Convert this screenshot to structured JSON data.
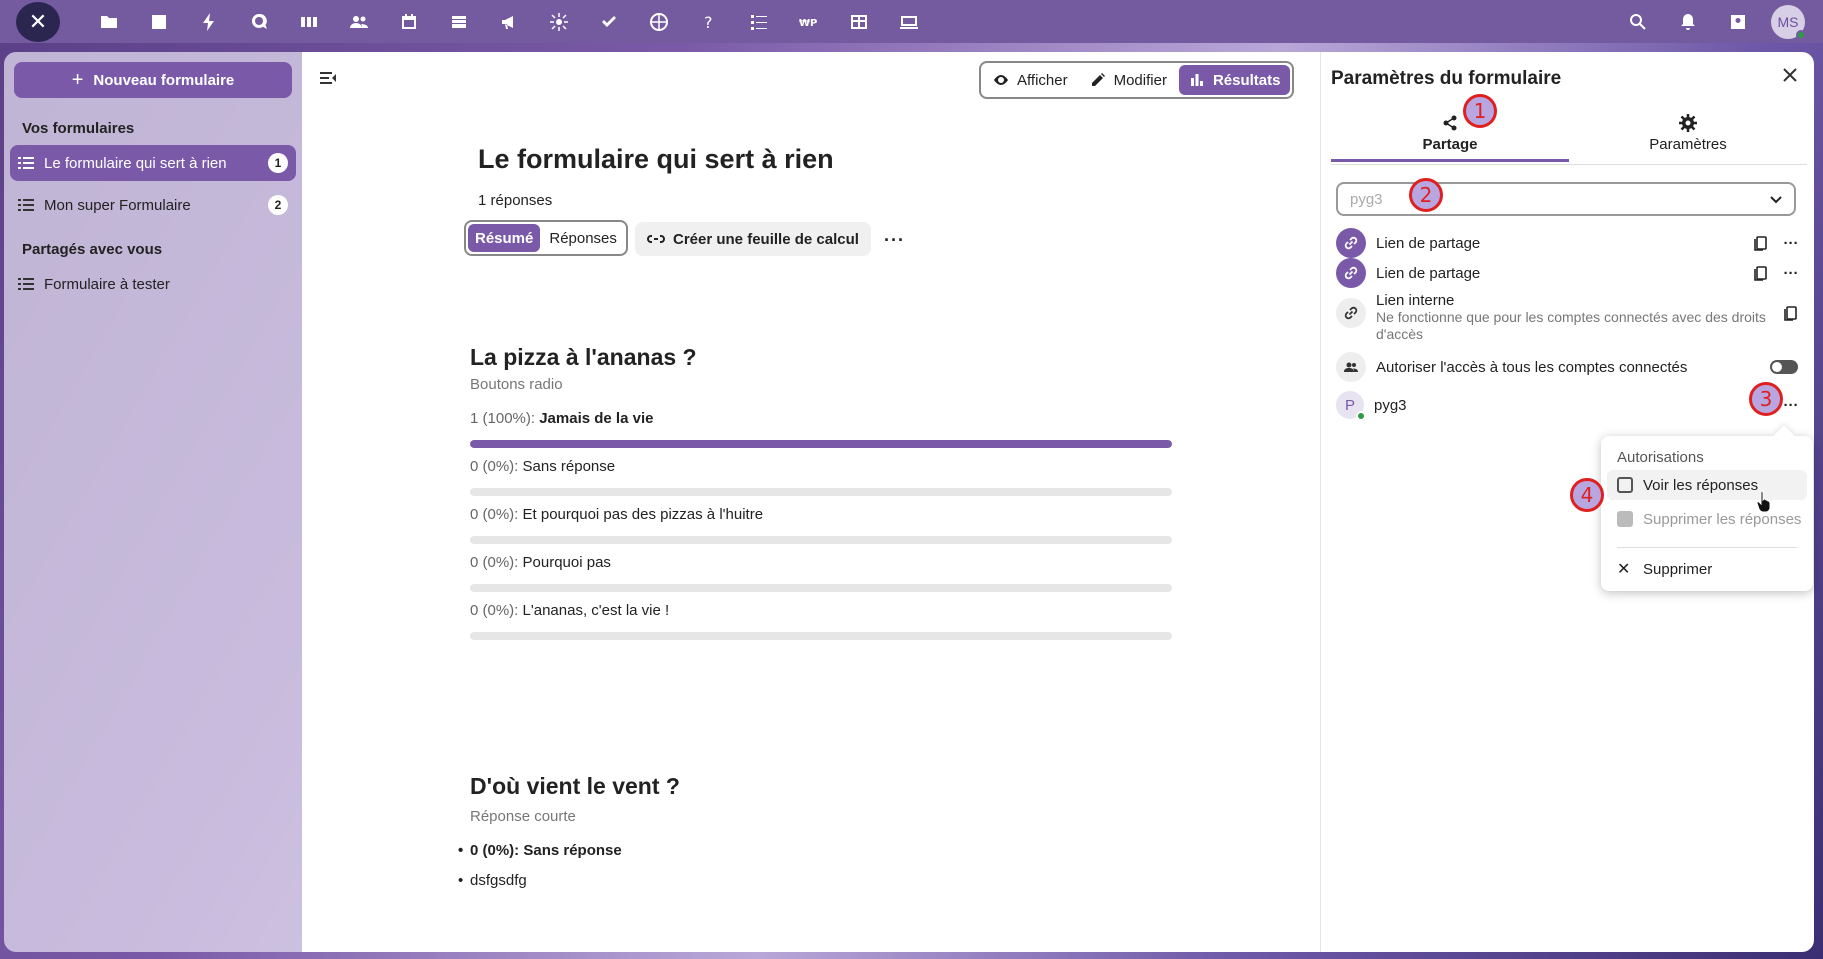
{
  "topbar": {
    "apps": [
      "files-icon",
      "photos-icon",
      "activity-icon",
      "talk-icon",
      "deck-icon",
      "contacts-icon",
      "calendar-icon",
      "drive-icon",
      "announcements-icon",
      "star-icon",
      "tasks-icon",
      "globe-icon",
      "help-icon",
      "forms-icon",
      "bank-icon",
      "tables-icon",
      "screen-icon"
    ],
    "user_initials": "MS"
  },
  "sidebar": {
    "new_button": "Nouveau formulaire",
    "section_mine": "Vos formulaires",
    "my_forms": [
      {
        "label": "Le formulaire qui sert à rien",
        "count": "1"
      },
      {
        "label": "Mon super Formulaire",
        "count": "2"
      }
    ],
    "section_shared": "Partagés avec vous",
    "shared_forms": [
      {
        "label": "Formulaire à tester"
      }
    ]
  },
  "view_switch": {
    "view": "Afficher",
    "edit": "Modifier",
    "results": "Résultats"
  },
  "form": {
    "title": "Le formulaire qui sert à rien",
    "responses_count": "1 réponses",
    "tabs": {
      "summary": "Résumé",
      "responses": "Réponses"
    },
    "sheet_button": "Créer une feuille de calcul",
    "more": "···"
  },
  "questions": [
    {
      "title": "La pizza à l'ananas ?",
      "type": "Boutons radio",
      "answers": [
        {
          "stat": "1 (100%):",
          "label": "Jamais de la vie",
          "fraction": 1.0,
          "bold": true
        },
        {
          "stat": "0 (0%):",
          "label": "Sans réponse",
          "fraction": 0
        },
        {
          "stat": "0 (0%):",
          "label": "Et pourquoi pas des pizzas à l'huitre",
          "fraction": 0
        },
        {
          "stat": "0 (0%):",
          "label": "Pourquoi pas",
          "fraction": 0
        },
        {
          "stat": "0 (0%):",
          "label": "L'ananas, c'est la vie !",
          "fraction": 0
        }
      ]
    },
    {
      "title": "D'où vient le vent ?",
      "type": "Réponse courte",
      "items": [
        "0 (0%): Sans réponse",
        "dsfgsdfg"
      ]
    }
  ],
  "panel": {
    "title": "Paramètres du formulaire",
    "tab_share": "Partage",
    "tab_settings": "Paramètres",
    "search_value": "pyg3",
    "share_link_1": "Lien de partage",
    "share_link_2": "Lien de partage",
    "internal_link": "Lien interne",
    "internal_link_desc": "Ne fonctionne que pour les comptes connectés avec des droits d'accès",
    "allow_all": "Autoriser l'accès à tous les comptes connectés",
    "allow_all_enabled": false,
    "user_initial": "P",
    "user_name": "pyg3"
  },
  "popover": {
    "caption": "Autorisations",
    "see_responses": "Voir les réponses",
    "delete_responses": "Supprimer les réponses",
    "remove": "Supprimer"
  },
  "markers": [
    "1",
    "2",
    "3",
    "4"
  ],
  "colors": {
    "accent": "#7a5aa8",
    "topbar": "#745a9e",
    "marker": "#e02020"
  }
}
